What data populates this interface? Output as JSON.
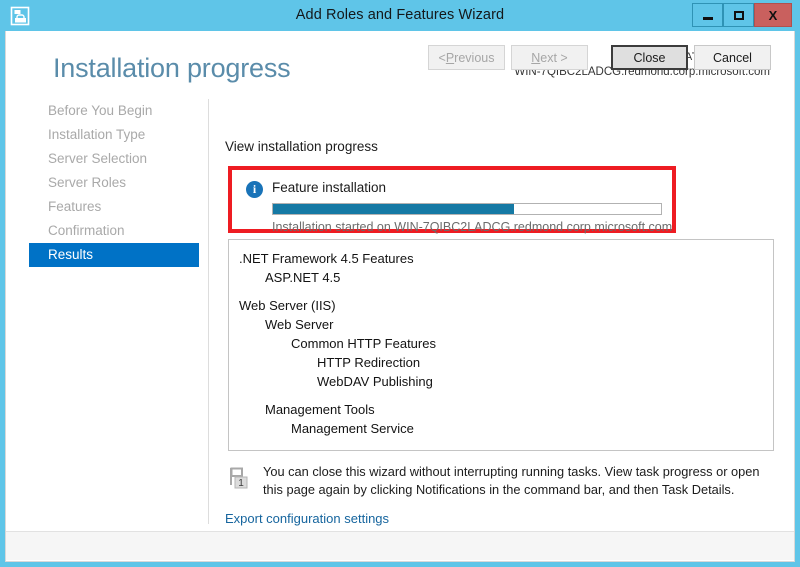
{
  "window": {
    "title": "Add Roles and Features Wizard",
    "app_icon": "toolbox-icon",
    "controls": {
      "minimize": "minimize-icon",
      "maximize": "maximize-icon",
      "close": "X"
    }
  },
  "header": {
    "page_title": "Installation progress",
    "destination_label": "DESTINATION SERVER",
    "destination_value": "WIN-7QIBC2LADCG.redmond.corp.microsoft.com"
  },
  "sidebar": {
    "items": [
      {
        "label": "Before You Begin",
        "active": false
      },
      {
        "label": "Installation Type",
        "active": false
      },
      {
        "label": "Server Selection",
        "active": false
      },
      {
        "label": "Server Roles",
        "active": false
      },
      {
        "label": "Features",
        "active": false
      },
      {
        "label": "Confirmation",
        "active": false
      },
      {
        "label": "Results",
        "active": true
      }
    ]
  },
  "main": {
    "view_progress_label": "View installation progress",
    "notification": {
      "icon": "info-icon",
      "icon_glyph": "i",
      "title": "Feature installation",
      "progress_percent": 62,
      "status_text": "Installation started on WIN-7QIBC2LADCG.redmond.corp.microsoft.com",
      "highlight_color": "#ee1c22",
      "progress_fill_color": "#1579a4"
    },
    "results": [
      {
        "label": ".NET Framework 4.5 Features",
        "indent": 0
      },
      {
        "label": "ASP.NET 4.5",
        "indent": 1
      },
      {
        "label": "",
        "indent": 0,
        "spacer": true
      },
      {
        "label": "Web Server (IIS)",
        "indent": 0
      },
      {
        "label": "Web Server",
        "indent": 1
      },
      {
        "label": "Common HTTP Features",
        "indent": 2
      },
      {
        "label": "HTTP Redirection",
        "indent": 3
      },
      {
        "label": "WebDAV Publishing",
        "indent": 3
      },
      {
        "label": "",
        "indent": 0,
        "spacer": true
      },
      {
        "label": "Management Tools",
        "indent": 1
      },
      {
        "label": "Management Service",
        "indent": 2
      }
    ],
    "notice": {
      "icon": "notification-flag-icon",
      "badge": "1",
      "text": "You can close this wizard without interrupting running tasks. View task progress or open this page again by clicking Notifications in the command bar, and then Task Details."
    },
    "export_link": "Export configuration settings"
  },
  "footer": {
    "buttons": [
      {
        "name": "previous",
        "label": "< Previous",
        "accel": "P",
        "disabled": true,
        "default": false
      },
      {
        "name": "next",
        "label": "Next >",
        "accel": "N",
        "disabled": true,
        "default": false
      },
      {
        "name": "close",
        "label": "Close",
        "accel": "",
        "disabled": false,
        "default": true
      },
      {
        "name": "cancel",
        "label": "Cancel",
        "accel": "",
        "disabled": false,
        "default": false
      }
    ]
  },
  "colors": {
    "titlebar": "#5fc5e8",
    "accent": "#0072c6",
    "title_text": "#5a8caa",
    "close_button": "#c9605e"
  }
}
